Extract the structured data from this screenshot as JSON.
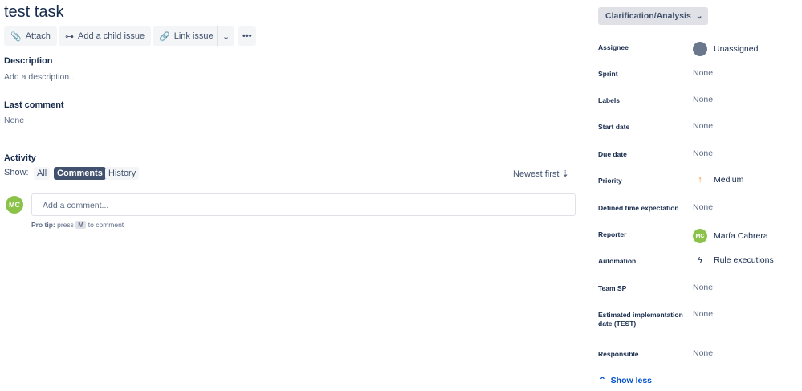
{
  "title": "test task",
  "toolbar": {
    "attach": "Attach",
    "child": "Add a child issue",
    "link": "Link issue"
  },
  "description": {
    "heading": "Description",
    "placeholder": "Add a description..."
  },
  "last_comment": {
    "heading": "Last comment",
    "value": "None"
  },
  "activity": {
    "heading": "Activity",
    "show": "Show:",
    "filters": [
      "All",
      "Comments",
      "History"
    ],
    "sort": "Newest first",
    "comment_placeholder": "Add a comment...",
    "avatar": "MC",
    "tip_bold": "Pro tip:",
    "tip_press": "press",
    "tip_key": "M",
    "tip_rest": "to comment"
  },
  "status": "Clarification/Analysis",
  "fields": [
    {
      "label": "Assignee",
      "value": "Unassigned"
    },
    {
      "label": "Sprint",
      "value": "None"
    },
    {
      "label": "Labels",
      "value": "None"
    },
    {
      "label": "Start date",
      "value": "None"
    },
    {
      "label": "Due date",
      "value": "None"
    },
    {
      "label": "Priority",
      "value": "Medium"
    },
    {
      "label": "Defined time expectation",
      "value": "None"
    },
    {
      "label": "Reporter",
      "value": "María Cabrera",
      "avatar": "MC"
    },
    {
      "label": "Automation",
      "value": "Rule executions"
    },
    {
      "label": "Team SP",
      "value": "None"
    },
    {
      "label": "Estimated implementation date (TEST)",
      "value": "None"
    },
    {
      "label": "Responsible",
      "value": "None"
    }
  ],
  "show_less": "Show less",
  "colors": {
    "accent": "#0052cc",
    "avatar": "#8bc34a",
    "priority": "#ff7a00",
    "active_chip": "#42526e"
  }
}
